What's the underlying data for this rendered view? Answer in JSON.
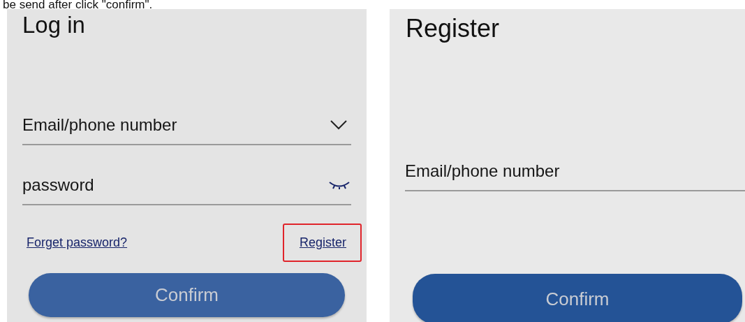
{
  "caption": "be send after click \"confirm\".",
  "screens": [
    {
      "kind": "login",
      "title": "Log in",
      "fields": [
        {
          "kind": "dropdown",
          "placeholder": "Email/phone number"
        },
        {
          "kind": "password",
          "placeholder": "password",
          "password_visible": false
        }
      ],
      "links": [
        {
          "label": "Forget password?",
          "highlighted": false
        },
        {
          "label": "Register",
          "highlighted": true
        }
      ],
      "button": "Confirm"
    },
    {
      "kind": "register",
      "title": "Register",
      "fields": [
        {
          "kind": "text",
          "placeholder": "Email/phone number"
        }
      ],
      "button": "Confirm"
    }
  ]
}
